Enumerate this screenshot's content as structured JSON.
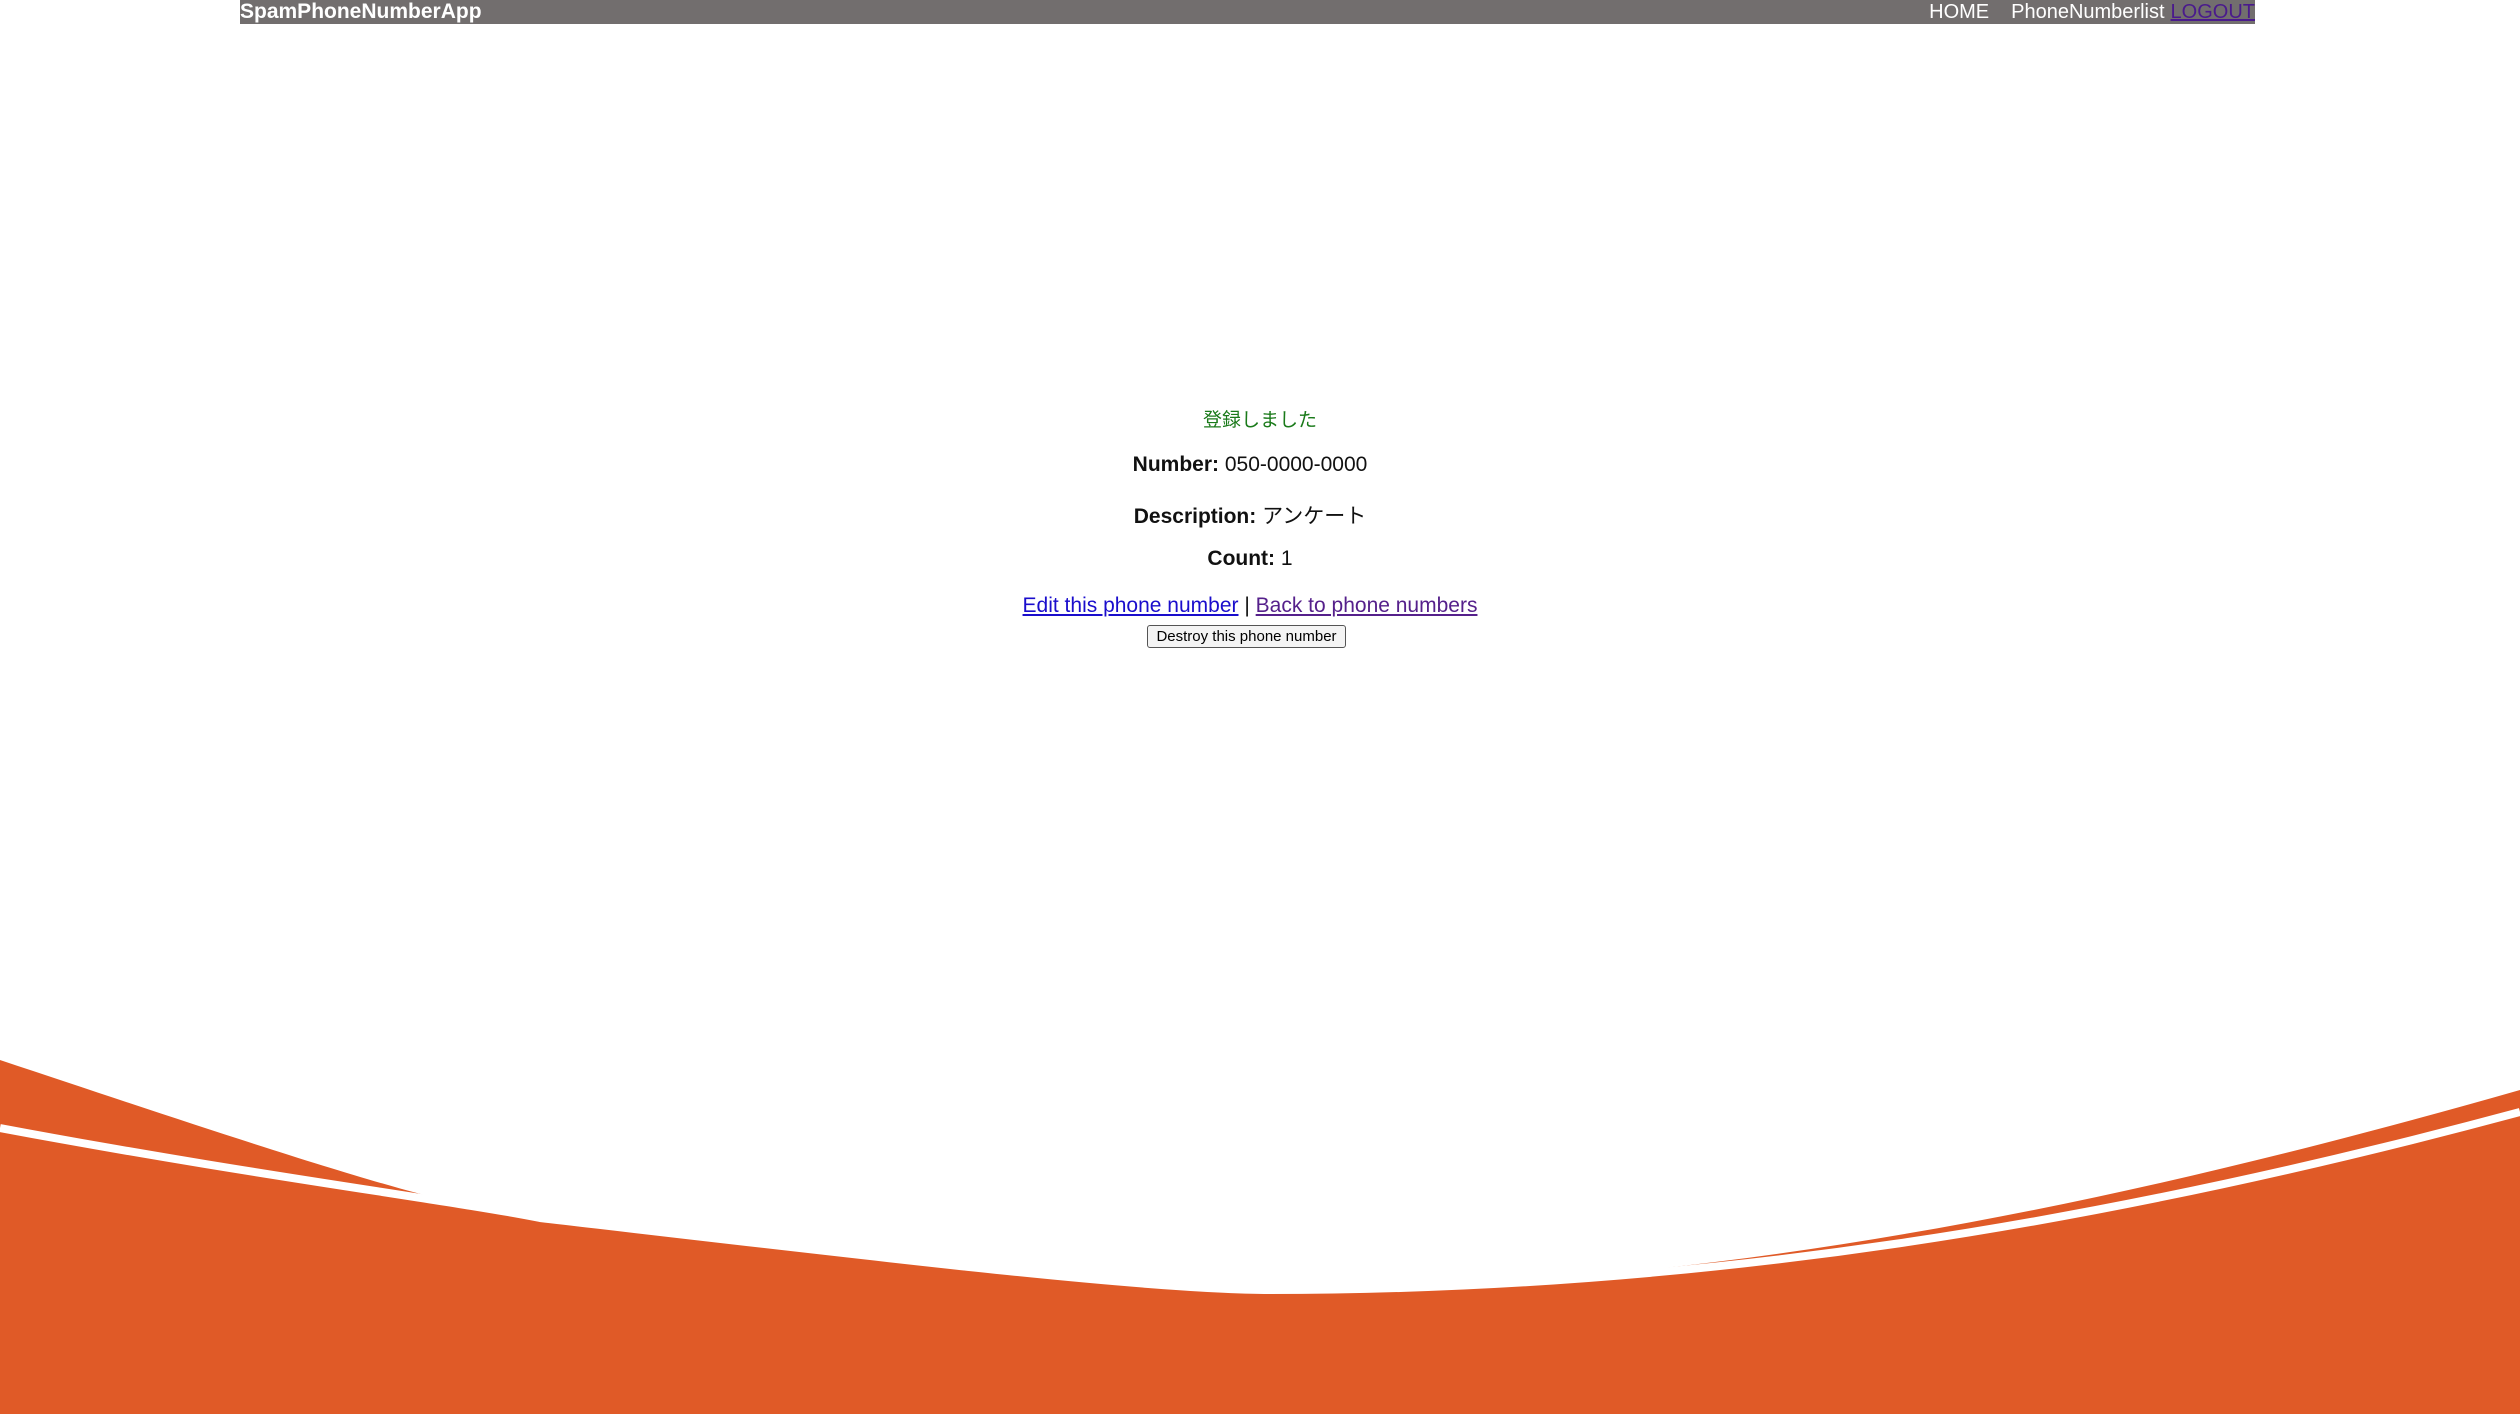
{
  "navbar": {
    "brand": "SpamPhoneNumberApp",
    "home": "HOME",
    "list": "PhoneNumberlist",
    "logout": "LOGOUT"
  },
  "notice": "登録しました",
  "record": {
    "number_label": "Number:",
    "number_value": "050-0000-0000",
    "description_label": "Description:",
    "description_value": "アンケート",
    "count_label": "Count:",
    "count_value": "1"
  },
  "actions": {
    "edit_label": "Edit this phone number",
    "separator": "|",
    "back_label": "Back to phone numbers",
    "destroy_label": "Destroy this phone number"
  },
  "colors": {
    "navbar_bg": "#726e6e",
    "accent_orange": "#e05a27",
    "notice_green": "#1a7a1a"
  }
}
